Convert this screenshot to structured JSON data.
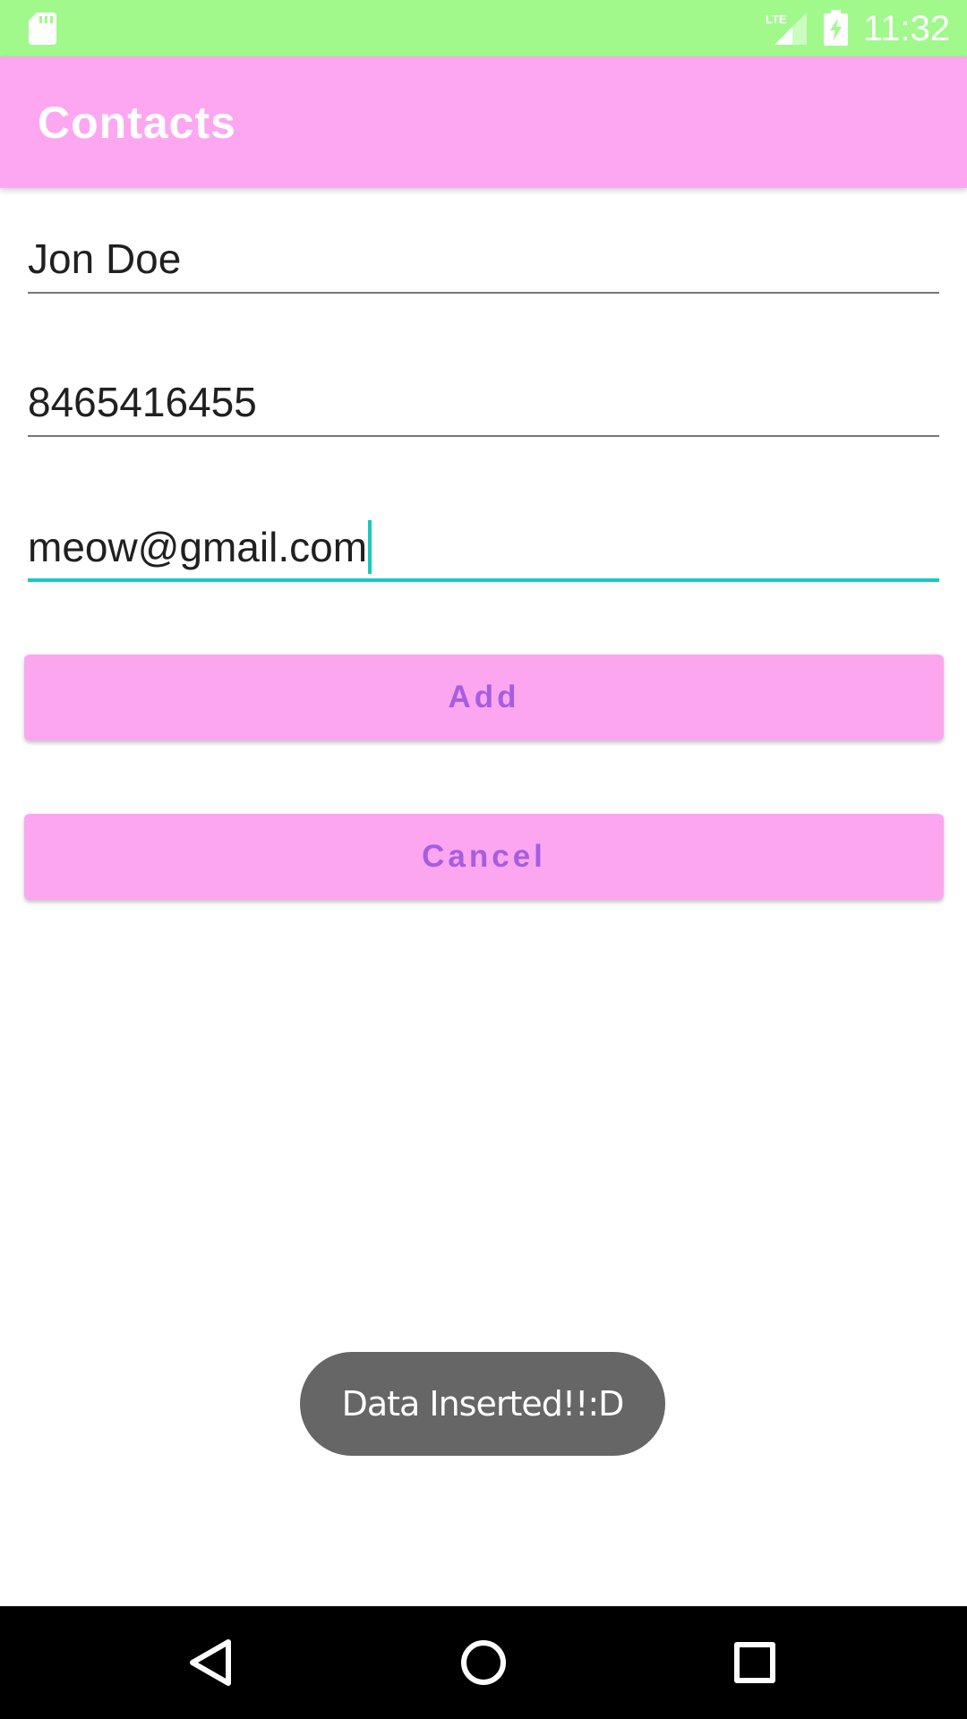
{
  "status_bar": {
    "time": "11:32",
    "icons": [
      "sd-card-icon",
      "lte-signal-icon",
      "battery-charging-icon"
    ],
    "background": "#a1f98c"
  },
  "app_bar": {
    "title": "Contacts",
    "background": "#fda7f1"
  },
  "form": {
    "name_value": "Jon Doe",
    "phone_value": "8465416455",
    "email_value": "meow@gmail.com",
    "active_field": "email",
    "accent_color": "#19c9c0"
  },
  "buttons": {
    "add_label": "Add",
    "cancel_label": "Cancel",
    "background": "#fca6f0",
    "text_color": "#a45ee0"
  },
  "toast": {
    "message": "Data Inserted!!:D"
  },
  "nav_bar": {
    "icons": [
      "back-icon",
      "home-icon",
      "recents-icon"
    ]
  }
}
